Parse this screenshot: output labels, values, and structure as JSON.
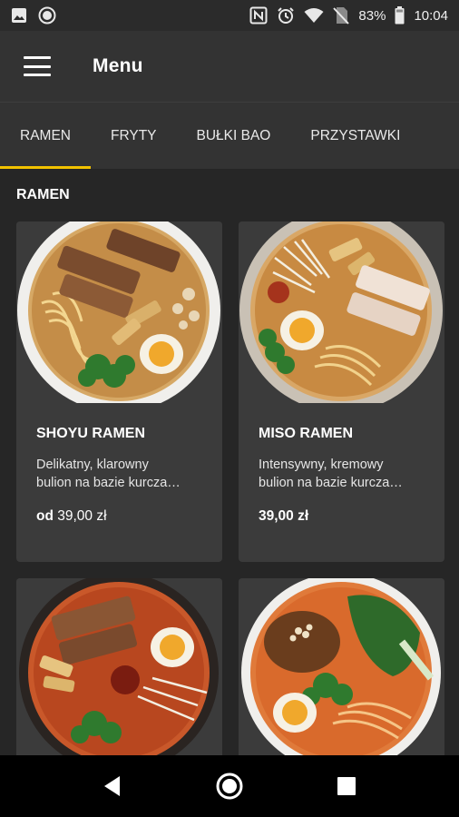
{
  "status_bar": {
    "battery": "83%",
    "time": "10:04",
    "icons": [
      "image-icon",
      "circle-notification-icon",
      "nfc-icon",
      "alarm-icon",
      "wifi-icon",
      "no-sim-icon",
      "battery-icon"
    ]
  },
  "app_bar": {
    "title": "Menu",
    "menu_icon": "hamburger-menu-icon"
  },
  "tabs": [
    {
      "label": "RAMEN",
      "active": true
    },
    {
      "label": "FRYTY",
      "active": false
    },
    {
      "label": "BUŁKI BAO",
      "active": false
    },
    {
      "label": "PRZYSTAWKI",
      "active": false
    }
  ],
  "section": {
    "title": "RAMEN"
  },
  "items": [
    {
      "name": "SHOYU RAMEN",
      "desc_line1": "Delikatny, klarowny",
      "desc_line2": "bulion na bazie kurcza…",
      "price_prefix": "od",
      "price": "39,00 zł"
    },
    {
      "name": "MISO RAMEN",
      "desc_line1": "Intensywny, kremowy",
      "desc_line2": "bulion na bazie kurcza…",
      "price_prefix": "",
      "price": "39,00 zł"
    },
    {
      "name": "",
      "price": ""
    },
    {
      "name": "",
      "price": ""
    }
  ],
  "colors": {
    "accent": "#f2c200",
    "background": "#262626",
    "card": "#3b3b3b",
    "bar": "#333333"
  },
  "nav_bar": {
    "icons": [
      "back-icon",
      "home-icon",
      "recents-icon"
    ]
  }
}
